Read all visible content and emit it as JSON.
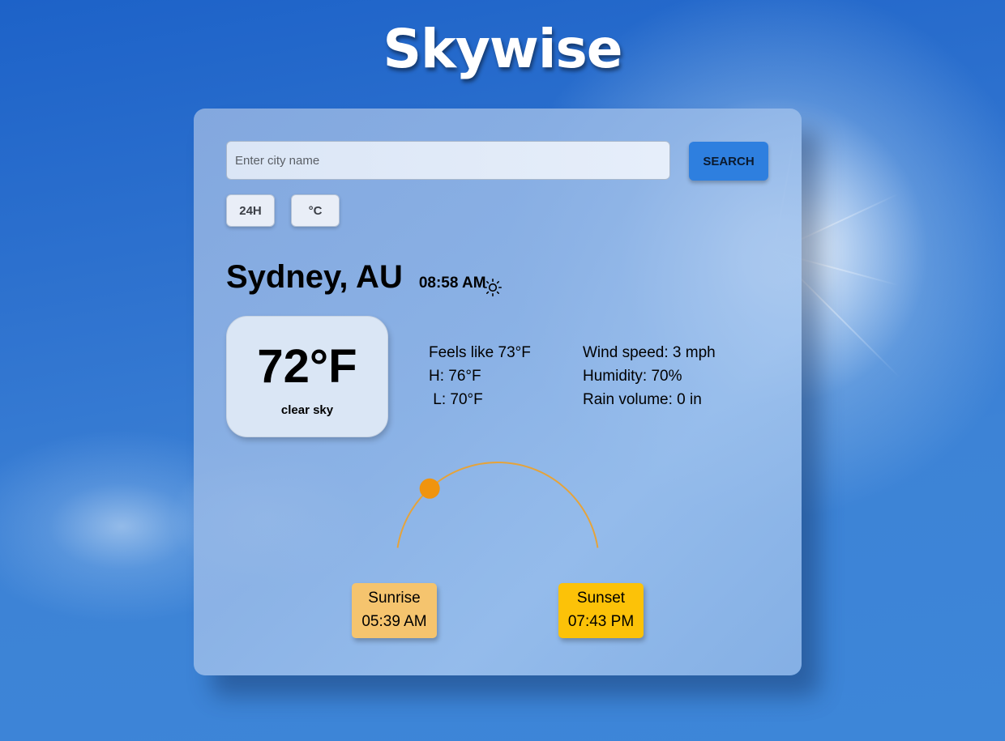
{
  "app": {
    "title": "Skywise"
  },
  "search": {
    "placeholder": "Enter city name",
    "value": "",
    "button_label": "SEARCH"
  },
  "toggles": {
    "time_format_label": "24H",
    "unit_label": "°C"
  },
  "location": {
    "city": "Sydney, AU",
    "time": "08:58 AM",
    "condition_icon": "sun-icon"
  },
  "current": {
    "temperature": "72°F",
    "description": "clear sky"
  },
  "details": {
    "feels_like": "Feels like 73°F",
    "high": "H: 76°F",
    "low": " L: 70°F",
    "wind_speed": "Wind speed: 3 mph",
    "humidity": "Humidity: 70%",
    "rain_volume": "Rain volume: 0 in"
  },
  "sun_path": {
    "progress": 0.24,
    "sunrise_label": "Sunrise",
    "sunrise_time": "05:39 AM",
    "sunset_label": "Sunset",
    "sunset_time": "07:43 PM"
  },
  "colors": {
    "accent": "#2e7fdf",
    "arc": "#e5a33a",
    "sun_marker": "#f0940e",
    "sunrise_bg": "#f5c46e",
    "sunset_bg": "#fcc208"
  }
}
